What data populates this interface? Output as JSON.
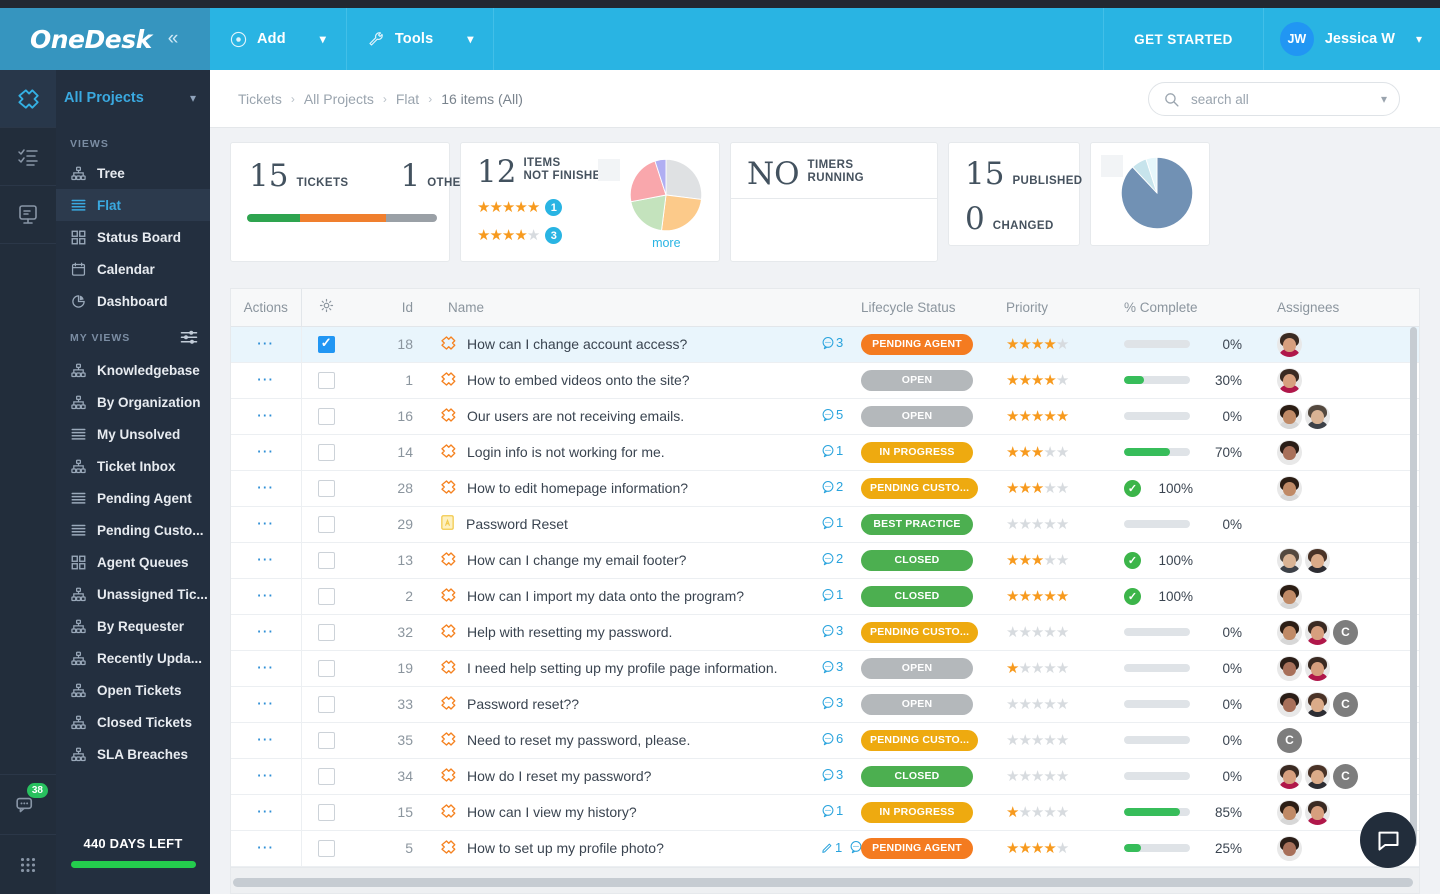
{
  "header": {
    "brand": "OneDesk",
    "collapse_icon": "double-chevron-left-icon",
    "add_label": "Add",
    "tools_label": "Tools",
    "get_started_label": "GET STARTED",
    "user_initials": "JW",
    "user_name": "Jessica W"
  },
  "breadcrumb": {
    "items": [
      "Tickets",
      "All Projects",
      "Flat",
      "16 items (All)"
    ],
    "separator": "›"
  },
  "search": {
    "placeholder": "search all"
  },
  "rail": {
    "items": [
      {
        "name": "tickets-rail-icon",
        "active": true
      },
      {
        "name": "tasks-rail-icon",
        "active": false
      },
      {
        "name": "knowledgebase-rail-icon",
        "active": false
      }
    ],
    "chat_badge": "38"
  },
  "sidebar": {
    "project_selector": "All Projects",
    "views_title": "VIEWS",
    "my_views_title": "MY VIEWS",
    "views": [
      {
        "label": "Tree",
        "icon": "tree-icon",
        "active": false
      },
      {
        "label": "Flat",
        "icon": "flat-list-icon",
        "active": true
      },
      {
        "label": "Status Board",
        "icon": "board-icon",
        "active": false
      },
      {
        "label": "Calendar",
        "icon": "calendar-icon",
        "active": false
      },
      {
        "label": "Dashboard",
        "icon": "pie-chart-icon",
        "active": false
      }
    ],
    "my_views": [
      {
        "label": "Knowledgebase",
        "icon": "tree-icon"
      },
      {
        "label": "By Organization",
        "icon": "tree-icon"
      },
      {
        "label": "My Unsolved",
        "icon": "flat-list-icon"
      },
      {
        "label": "Ticket Inbox",
        "icon": "tree-icon"
      },
      {
        "label": "Pending Agent",
        "icon": "flat-list-icon"
      },
      {
        "label": "Pending Custo...",
        "icon": "flat-list-icon"
      },
      {
        "label": "Agent Queues",
        "icon": "board-icon"
      },
      {
        "label": "Unassigned Tic...",
        "icon": "tree-icon"
      },
      {
        "label": "By Requester",
        "icon": "tree-icon"
      },
      {
        "label": "Recently Upda...",
        "icon": "tree-icon"
      },
      {
        "label": "Open Tickets",
        "icon": "tree-icon"
      },
      {
        "label": "Closed Tickets",
        "icon": "tree-icon"
      },
      {
        "label": "SLA Breaches",
        "icon": "tree-icon"
      }
    ],
    "trial": {
      "label": "440 DAYS LEFT",
      "bar_color": "#24cc4d"
    }
  },
  "cards": {
    "tickets": {
      "count": "15",
      "count_label": "TICKETS",
      "other_count": "1",
      "other_label": "OTHER",
      "segments": [
        {
          "color": "#2ea44f",
          "pct": 28
        },
        {
          "color": "#f07f2e",
          "pct": 45
        },
        {
          "color": "#9aa0a6",
          "pct": 27
        }
      ]
    },
    "not_finished": {
      "count": "12",
      "label_line1": "ITEMS",
      "label_line2": "NOT FINISHED",
      "ratings": [
        {
          "filled": 5,
          "total": 5,
          "count": "1"
        },
        {
          "filled": 4,
          "total": 5,
          "count": "3"
        }
      ],
      "more_label": "more",
      "pie": [
        {
          "color": "#dfe1e3",
          "pct": 27
        },
        {
          "color": "#fcca8a",
          "pct": 25
        },
        {
          "color": "#c4e3bd",
          "pct": 20
        },
        {
          "color": "#f9a7ac",
          "pct": 23
        },
        {
          "color": "#b0aef2",
          "pct": 5
        }
      ]
    },
    "timers": {
      "count": "NO",
      "label_line1": "TIMERS",
      "label_line2": "RUNNING"
    },
    "published": {
      "count": "15",
      "label": "PUBLISHED",
      "changed_count": "0",
      "changed_label": "CHANGED"
    },
    "published_pie": [
      {
        "color": "#7191b4",
        "pct": 88
      },
      {
        "color": "#c7e4ec",
        "pct": 7
      },
      {
        "color": "#e6f7fb",
        "pct": 5
      }
    ]
  },
  "table": {
    "columns": [
      "Actions",
      "gear-icon",
      "Id",
      "Name",
      "",
      "Lifecycle Status",
      "Priority",
      "% Complete",
      "Assignees"
    ],
    "rows": [
      {
        "id": "18",
        "name": "How can I change account access?",
        "type_icon": "ticket-icon",
        "conversations": "3",
        "attachments": "",
        "status": "PENDING AGENT",
        "status_key": "b-pending-agent",
        "priority": 4,
        "pct": "0%",
        "pct_val": 0,
        "complete": false,
        "avatars": [
          "f1"
        ],
        "selected": true
      },
      {
        "id": "1",
        "name": "How to embed videos onto the site?",
        "type_icon": "ticket-icon",
        "conversations": "",
        "attachments": "",
        "status": "OPEN",
        "status_key": "b-open",
        "priority": 4,
        "pct": "30%",
        "pct_val": 30,
        "complete": false,
        "avatars": [
          "f1"
        ],
        "selected": false
      },
      {
        "id": "16",
        "name": "Our users are not receiving emails.",
        "type_icon": "ticket-icon",
        "conversations": "5",
        "attachments": "",
        "status": "OPEN",
        "status_key": "b-open",
        "priority": 5,
        "pct": "0%",
        "pct_val": 0,
        "complete": false,
        "avatars": [
          "m1",
          "m2"
        ],
        "selected": false
      },
      {
        "id": "14",
        "name": "Login info is not working for me.",
        "type_icon": "ticket-icon",
        "conversations": "1",
        "attachments": "",
        "status": "IN PROGRESS",
        "status_key": "b-inprogress",
        "priority": 3,
        "pct": "70%",
        "pct_val": 70,
        "complete": false,
        "avatars": [
          "f2"
        ],
        "selected": false
      },
      {
        "id": "28",
        "name": "How to edit homepage information?",
        "type_icon": "ticket-icon",
        "conversations": "2",
        "attachments": "",
        "status": "PENDING CUSTO...",
        "status_key": "b-pending-cust",
        "priority": 3,
        "pct": "100%",
        "pct_val": 100,
        "complete": true,
        "avatars": [
          "m1"
        ],
        "selected": false
      },
      {
        "id": "29",
        "name": "Password Reset",
        "type_icon": "article-icon",
        "conversations": "1",
        "attachments": "",
        "status": "BEST PRACTICE",
        "status_key": "b-best",
        "priority": 0,
        "pct": "0%",
        "pct_val": 0,
        "complete": false,
        "avatars": [],
        "selected": false
      },
      {
        "id": "13",
        "name": "How can I change my email footer?",
        "type_icon": "ticket-icon",
        "conversations": "2",
        "attachments": "",
        "status": "CLOSED",
        "status_key": "b-closed",
        "priority": 3,
        "pct": "100%",
        "pct_val": 100,
        "complete": true,
        "avatars": [
          "m2",
          "f3"
        ],
        "selected": false
      },
      {
        "id": "2",
        "name": "How can I import my data onto the program?",
        "type_icon": "ticket-icon",
        "conversations": "1",
        "attachments": "",
        "status": "CLOSED",
        "status_key": "b-closed",
        "priority": 5,
        "pct": "100%",
        "pct_val": 100,
        "complete": true,
        "avatars": [
          "m1"
        ],
        "selected": false
      },
      {
        "id": "32",
        "name": "Help with resetting my password.",
        "type_icon": "ticket-icon",
        "conversations": "3",
        "attachments": "",
        "status": "PENDING CUSTO...",
        "status_key": "b-pending-cust",
        "priority": 0,
        "pct": "0%",
        "pct_val": 0,
        "complete": false,
        "avatars": [
          "m1",
          "f1",
          "C"
        ],
        "selected": false
      },
      {
        "id": "19",
        "name": "I need help setting up my profile page information.",
        "type_icon": "ticket-icon",
        "conversations": "3",
        "attachments": "",
        "status": "OPEN",
        "status_key": "b-open",
        "priority": 1,
        "pct": "0%",
        "pct_val": 0,
        "complete": false,
        "avatars": [
          "f2",
          "f1"
        ],
        "selected": false
      },
      {
        "id": "33",
        "name": "Password reset??",
        "type_icon": "ticket-icon",
        "conversations": "3",
        "attachments": "",
        "status": "OPEN",
        "status_key": "b-open",
        "priority": 0,
        "pct": "0%",
        "pct_val": 0,
        "complete": false,
        "avatars": [
          "f2",
          "f3",
          "C"
        ],
        "selected": false
      },
      {
        "id": "35",
        "name": "Need to reset my password, please.",
        "type_icon": "ticket-icon",
        "conversations": "6",
        "attachments": "",
        "status": "PENDING CUSTO...",
        "status_key": "b-pending-cust",
        "priority": 0,
        "pct": "0%",
        "pct_val": 0,
        "complete": false,
        "avatars": [
          "C"
        ],
        "selected": false
      },
      {
        "id": "34",
        "name": "How do I reset my password?",
        "type_icon": "ticket-icon",
        "conversations": "3",
        "attachments": "",
        "status": "CLOSED",
        "status_key": "b-closed",
        "priority": 0,
        "pct": "0%",
        "pct_val": 0,
        "complete": false,
        "avatars": [
          "f1",
          "f3",
          "C"
        ],
        "selected": false
      },
      {
        "id": "15",
        "name": "How can I view my history?",
        "type_icon": "ticket-icon",
        "conversations": "1",
        "attachments": "",
        "status": "IN PROGRESS",
        "status_key": "b-inprogress",
        "priority": 1,
        "pct": "85%",
        "pct_val": 85,
        "complete": false,
        "avatars": [
          "m1",
          "f1"
        ],
        "selected": false
      },
      {
        "id": "5",
        "name": "How to set up my profile photo?",
        "type_icon": "ticket-icon",
        "conversations": "1",
        "attachments": "1",
        "status": "PENDING AGENT",
        "status_key": "b-pending-agent",
        "priority": 4,
        "pct": "25%",
        "pct_val": 25,
        "complete": false,
        "avatars": [
          "f2"
        ],
        "selected": false
      }
    ]
  },
  "colors": {
    "brand_blue": "#29b4e3",
    "brand_dark_blue": "#3695bf",
    "sidebar_bg": "#232f3f",
    "accent_link": "#3aa9e0",
    "star_on": "#f79a1e",
    "progress_green": "#37bd5a"
  },
  "chat_fab": {
    "icon": "chat-bubble-icon"
  }
}
